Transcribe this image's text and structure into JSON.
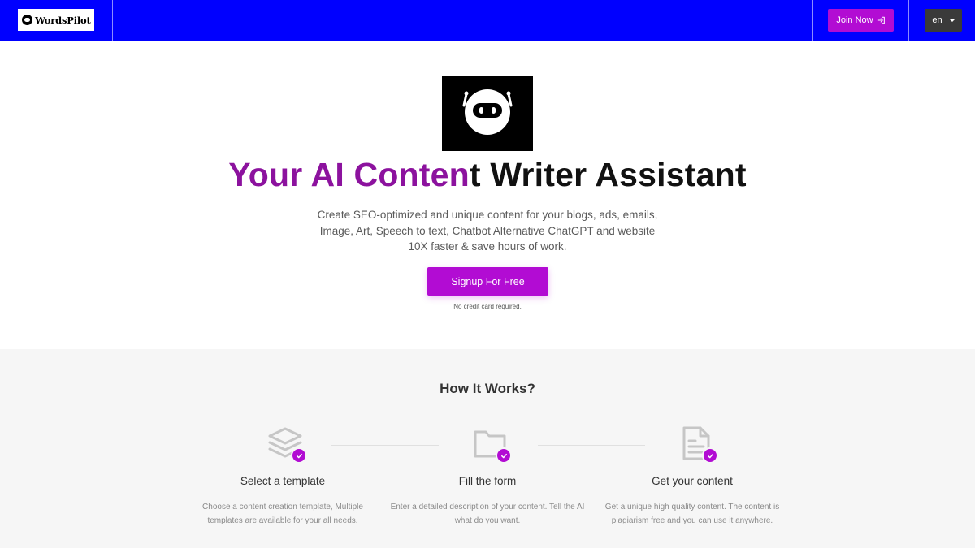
{
  "header": {
    "logo_text": "WordsPilot",
    "join_label": "Join Now",
    "lang_label": "en",
    "colors": {
      "bar": "#0000ff",
      "accent": "#b20cd3",
      "lang_bg": "#3a3a3a"
    }
  },
  "hero": {
    "title_highlight": "Your AI Conten",
    "title_rest": "t Writer Assistant",
    "subtitle": "Create SEO-optimized and unique content for your blogs, ads, emails, Image, Art, Speech to text, Chatbot Alternative ChatGPT and website 10X faster & save hours of work.",
    "cta_label": "Signup For Free",
    "note": "No credit card required.",
    "robot_icon": "robot-icon"
  },
  "how_it_works": {
    "title": "How It Works?",
    "steps": [
      {
        "icon": "layers-icon",
        "title": "Select a template",
        "description": "Choose a content creation template, Multiple templates are available for your all needs."
      },
      {
        "icon": "folder-icon",
        "title": "Fill the form",
        "description": "Enter a detailed description of your content. Tell the AI what do you want."
      },
      {
        "icon": "document-icon",
        "title": "Get your content",
        "description": "Get a unique high quality content. The content is plagiarism free and you can use it anywhere."
      }
    ]
  }
}
